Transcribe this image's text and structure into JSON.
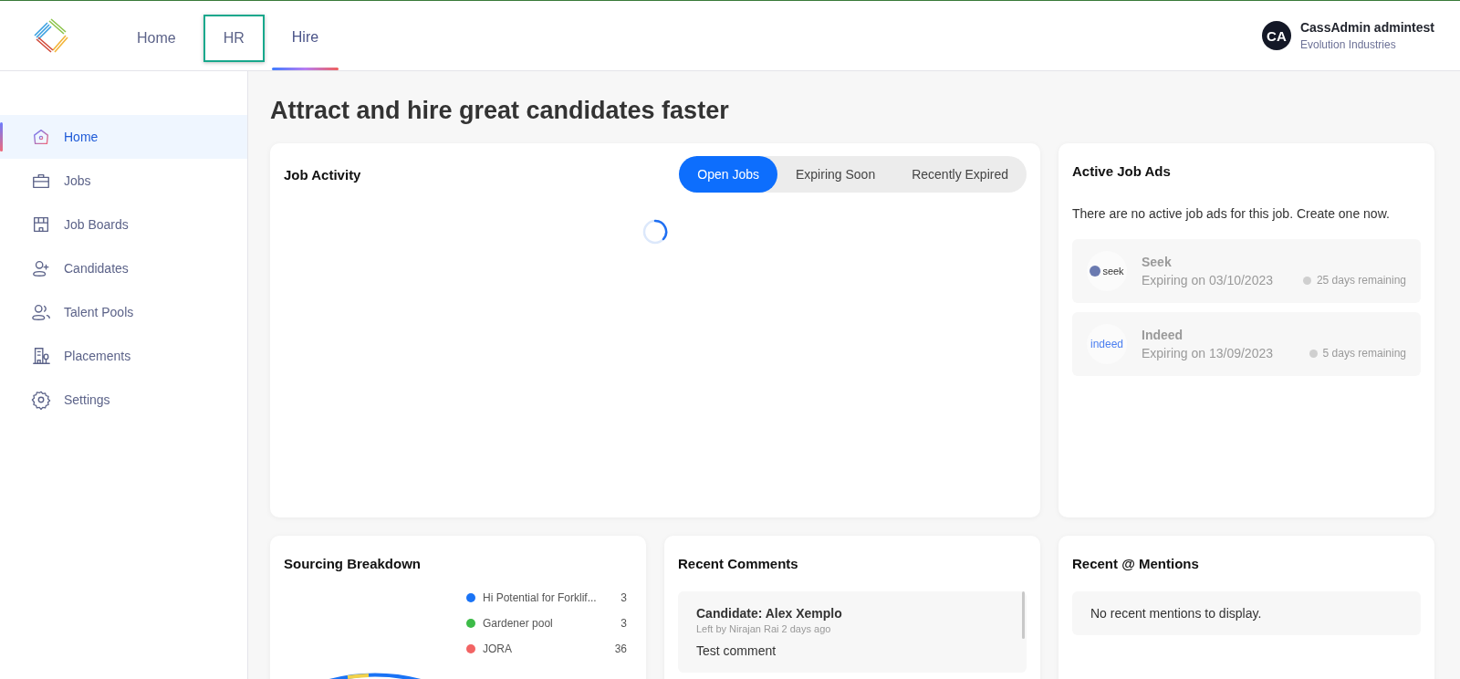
{
  "top_nav": {
    "tabs": [
      {
        "label": "Home",
        "selected": false,
        "highlighted": false
      },
      {
        "label": "HR",
        "selected": false,
        "highlighted": true
      },
      {
        "label": "Hire",
        "selected": true,
        "highlighted": false
      }
    ]
  },
  "user": {
    "initials": "CA",
    "name": "CassAdmin admintest",
    "company": "Evolution Industries"
  },
  "sidebar": {
    "items": [
      {
        "label": "Home",
        "kind": "home",
        "selected": true
      },
      {
        "label": "Jobs",
        "kind": "briefcase",
        "selected": false
      },
      {
        "label": "Job Boards",
        "kind": "store",
        "selected": false
      },
      {
        "label": "Candidates",
        "kind": "useradd",
        "selected": false
      },
      {
        "label": "Talent Pools",
        "kind": "users",
        "selected": false
      },
      {
        "label": "Placements",
        "kind": "building",
        "selected": false
      },
      {
        "label": "Settings",
        "kind": "gear",
        "selected": false
      }
    ]
  },
  "page_title": "Attract and hire great candidates faster",
  "job_activity": {
    "title": "Job Activity",
    "tabs": [
      {
        "label": "Open Jobs",
        "selected": true
      },
      {
        "label": "Expiring Soon",
        "selected": false
      },
      {
        "label": "Recently Expired",
        "selected": false
      }
    ]
  },
  "active_job_ads": {
    "title": "Active Job Ads",
    "message": "There are no active job ads for this job. Create one now.",
    "ads": [
      {
        "kind": "seek",
        "logo_text": "seek",
        "name": "Seek",
        "expiry": "Expiring on 03/10/2023",
        "remaining": "25 days remaining"
      },
      {
        "kind": "indeed",
        "logo_text": "indeed",
        "name": "Indeed",
        "expiry": "Expiring on 13/09/2023",
        "remaining": "5 days remaining"
      }
    ]
  },
  "sourcing_breakdown": {
    "title": "Sourcing Breakdown",
    "legend": [
      {
        "label": "Hi Potential for Forklif...",
        "count": "3",
        "color": "#1a73f5"
      },
      {
        "label": "Gardener pool",
        "count": "3",
        "color": "#3dbb48"
      },
      {
        "label": "JORA",
        "count": "36",
        "color": "#f26464"
      }
    ]
  },
  "recent_comments": {
    "title": "Recent Comments",
    "comments": [
      {
        "subject": "Candidate: Alex Xemplo",
        "meta": "Left by Nirajan Rai 2 days ago",
        "body": "Test comment"
      }
    ]
  },
  "recent_mentions": {
    "title": "Recent @ Mentions",
    "message": "No recent mentions to display."
  }
}
